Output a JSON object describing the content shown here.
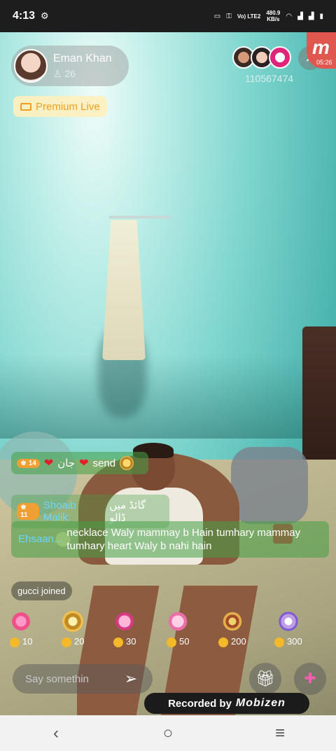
{
  "status_bar": {
    "time": "4:13",
    "settings_glyph": "⚙",
    "network_label": "Vo) LTE2",
    "speed": "480.9",
    "speed_unit": "KB/s"
  },
  "host": {
    "name": "Eman Khan",
    "viewers": "26",
    "badge": "Premium Live"
  },
  "room": {
    "id": "110567474",
    "recording_timer": "05:26"
  },
  "chat": [
    {
      "level": "14",
      "username": "جان",
      "text": "send"
    },
    {
      "level": "11",
      "username": "Shoaib Malik:",
      "text": "گائڈ میں ڈالو"
    },
    {
      "username": "Ehsaan...",
      "text": "necklace Waly mammay b Hain tumhary mammay tumhary heart Waly b nahi hain"
    },
    {
      "text": "gucci joined"
    }
  ],
  "gifts": [
    {
      "icon": "lollipop-icon",
      "price": "10"
    },
    {
      "icon": "ring-icon",
      "price": "20"
    },
    {
      "icon": "perfume-icon",
      "price": "30"
    },
    {
      "icon": "handbag-icon",
      "price": "50"
    },
    {
      "icon": "necklace-icon",
      "price": "200"
    },
    {
      "icon": "castle-icon",
      "price": "300"
    }
  ],
  "input": {
    "placeholder": "Say somethin"
  },
  "recorder": {
    "label": "Recorded by",
    "brand": "Mobizen"
  },
  "colors": {
    "premium": "#f0a020",
    "chat_bg": "#46a046",
    "record_red": "#e0574f"
  }
}
